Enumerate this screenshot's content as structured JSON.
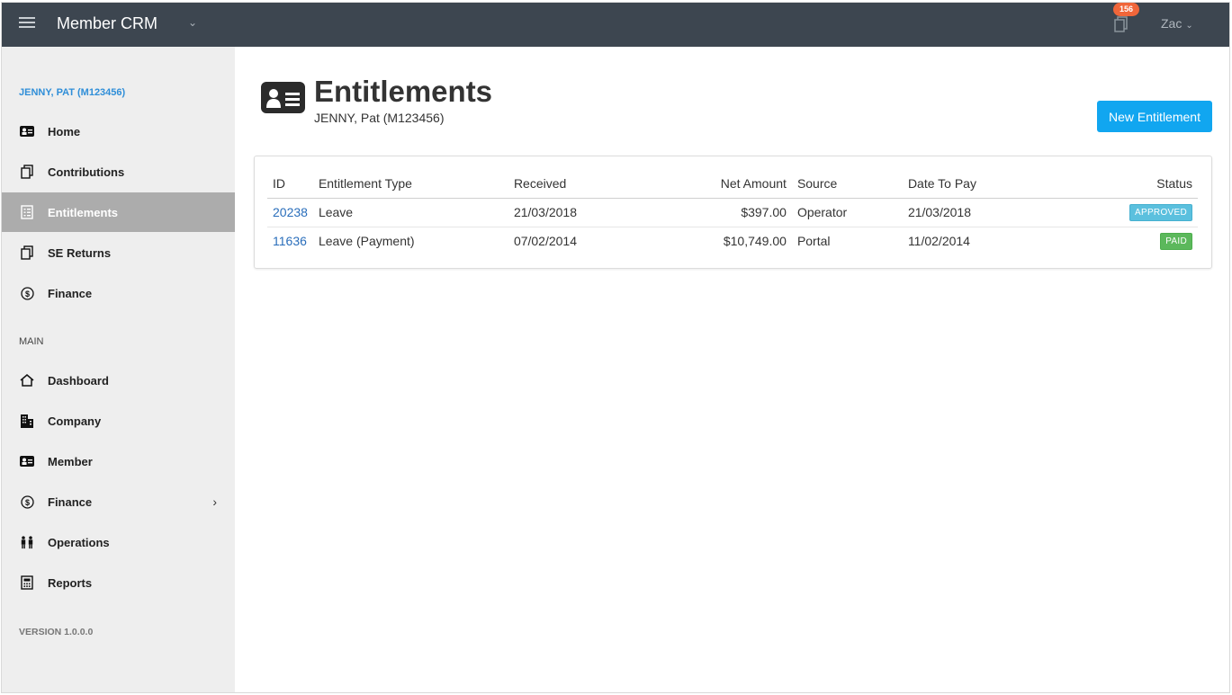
{
  "header": {
    "app_title": "Member CRM",
    "notification_count": "156",
    "user_name": "Zac"
  },
  "sidebar": {
    "member_name": "JENNY, PAT (M123456)",
    "member_items": [
      {
        "label": "Home",
        "icon": "id-card-icon"
      },
      {
        "label": "Contributions",
        "icon": "copy-icon"
      },
      {
        "label": "Entitlements",
        "icon": "document-list-icon",
        "active": true
      },
      {
        "label": "SE Returns",
        "icon": "copy-icon"
      },
      {
        "label": "Finance",
        "icon": "dollar-circle-icon"
      }
    ],
    "section_label": "MAIN",
    "main_items": [
      {
        "label": "Dashboard",
        "icon": "home-icon"
      },
      {
        "label": "Company",
        "icon": "building-icon"
      },
      {
        "label": "Member",
        "icon": "id-card-icon"
      },
      {
        "label": "Finance",
        "icon": "dollar-circle-icon",
        "has_submenu": true
      },
      {
        "label": "Operations",
        "icon": "people-icon"
      },
      {
        "label": "Reports",
        "icon": "calculator-icon"
      }
    ],
    "version": "VERSION 1.0.0.0"
  },
  "page": {
    "title": "Entitlements",
    "subtitle": "JENNY, Pat (M123456)",
    "new_button_label": "New Entitlement"
  },
  "table": {
    "columns": [
      "ID",
      "Entitlement Type",
      "Received",
      "Net Amount",
      "Source",
      "Date To Pay",
      "Status"
    ],
    "rows": [
      {
        "id": "20238",
        "type": "Leave",
        "received": "21/03/2018",
        "net_amount": "$397.00",
        "source": "Operator",
        "date_to_pay": "21/03/2018",
        "status": "APPROVED"
      },
      {
        "id": "11636",
        "type": "Leave (Payment)",
        "received": "07/02/2014",
        "net_amount": "$10,749.00",
        "source": "Portal",
        "date_to_pay": "11/02/2014",
        "status": "PAID"
      }
    ]
  },
  "colors": {
    "topbar": "#3d4650",
    "accent_link": "#2f8ed8",
    "primary_button": "#11a6f0",
    "approved_badge": "#5bc0de",
    "paid_badge": "#5cb85c",
    "notification_badge": "#f0663a"
  }
}
